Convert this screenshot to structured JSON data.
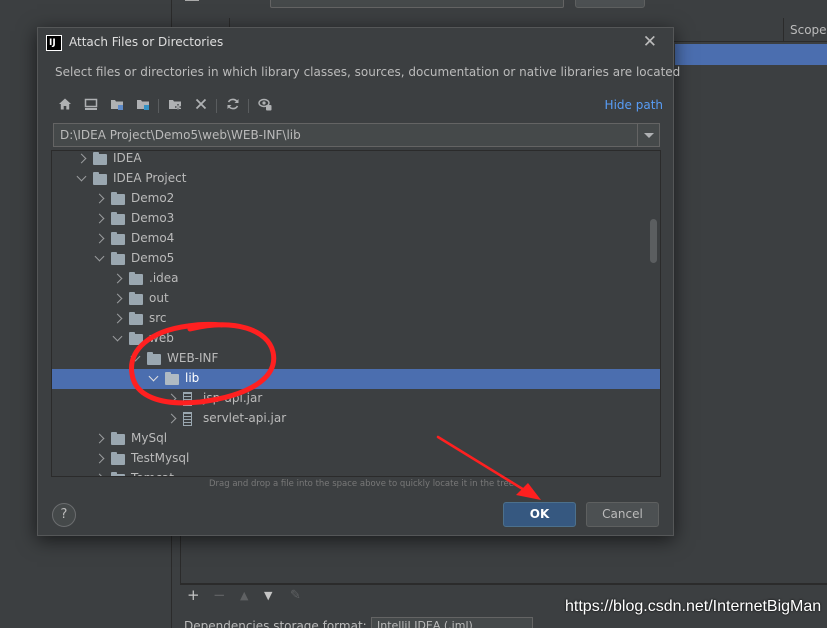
{
  "background": {
    "scope_header": "Scope",
    "bottom_label": "Dependencies storage format:",
    "bottom_select": "IntelliJ IDEA (.iml)",
    "toolbar": [
      "+",
      "−",
      "▲",
      "▼",
      "✎"
    ]
  },
  "dialog": {
    "title": "Attach Files or Directories",
    "description": "Select files or directories in which library classes, sources, documentation or native libraries are located",
    "hide_path": "Hide path",
    "path": "D:\\IDEA Project\\Demo5\\web\\WEB-INF\\lib",
    "hint": "Drag and drop a file into the space above to quickly locate it in the tree",
    "ok": "OK",
    "cancel": "Cancel",
    "help": "?"
  },
  "toolbar_icons": [
    "home-icon",
    "desktop-icon",
    "project-folder-icon",
    "module-folder-icon",
    "new-folder-icon",
    "delete-icon",
    "refresh-icon",
    "show-hidden-icon"
  ],
  "tree": [
    {
      "label": "IDEA",
      "type": "folder",
      "depth": 1,
      "state": "collapsed"
    },
    {
      "label": "IDEA Project",
      "type": "folder",
      "depth": 1,
      "state": "expanded"
    },
    {
      "label": "Demo2",
      "type": "folder",
      "depth": 2,
      "state": "collapsed"
    },
    {
      "label": "Demo3",
      "type": "folder",
      "depth": 2,
      "state": "collapsed"
    },
    {
      "label": "Demo4",
      "type": "folder",
      "depth": 2,
      "state": "collapsed"
    },
    {
      "label": "Demo5",
      "type": "folder",
      "depth": 2,
      "state": "expanded"
    },
    {
      "label": ".idea",
      "type": "folder",
      "depth": 3,
      "state": "collapsed"
    },
    {
      "label": "out",
      "type": "folder",
      "depth": 3,
      "state": "collapsed"
    },
    {
      "label": "src",
      "type": "folder",
      "depth": 3,
      "state": "collapsed"
    },
    {
      "label": "web",
      "type": "folder",
      "depth": 3,
      "state": "expanded"
    },
    {
      "label": "WEB-INF",
      "type": "folder",
      "depth": 4,
      "state": "expanded"
    },
    {
      "label": "lib",
      "type": "folder",
      "depth": 5,
      "state": "expanded",
      "selected": true
    },
    {
      "label": "jsp-api.jar",
      "type": "jar",
      "depth": 6,
      "state": "collapsed"
    },
    {
      "label": "servlet-api.jar",
      "type": "jar",
      "depth": 6,
      "state": "collapsed"
    },
    {
      "label": "MySql",
      "type": "folder",
      "depth": 2,
      "state": "collapsed"
    },
    {
      "label": "TestMysql",
      "type": "folder",
      "depth": 2,
      "state": "collapsed"
    },
    {
      "label": "Tomcat",
      "type": "folder",
      "depth": 2,
      "state": "collapsed"
    }
  ],
  "watermark": "https://blog.csdn.net/InternetBigMan",
  "colors": {
    "selection": "#4b6eaf",
    "ok_button": "#365880",
    "annotation": "#ff2020",
    "link": "#589df6"
  }
}
